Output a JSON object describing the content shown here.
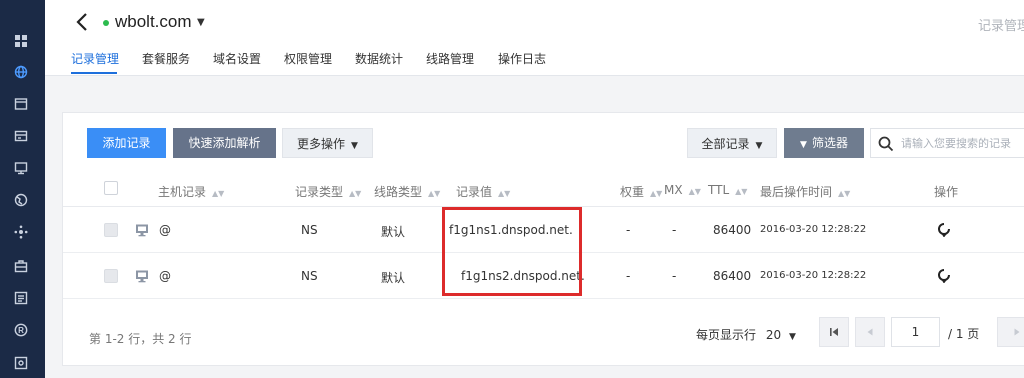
{
  "header": {
    "domain": "wbolt.com",
    "right_title": "记录管理"
  },
  "tabs": [
    {
      "label": "记录管理",
      "active": true
    },
    {
      "label": "套餐服务"
    },
    {
      "label": "域名设置"
    },
    {
      "label": "权限管理"
    },
    {
      "label": "数据统计"
    },
    {
      "label": "线路管理"
    },
    {
      "label": "操作日志"
    }
  ],
  "toolbar": {
    "add_record": "添加记录",
    "quick_add": "快速添加解析",
    "more_actions": "更多操作",
    "all_records": "全部记录",
    "filter": "筛选器",
    "search_placeholder": "请输入您要搜索的记录"
  },
  "table": {
    "columns": {
      "host": "主机记录",
      "type": "记录类型",
      "line": "线路类型",
      "value": "记录值",
      "weight": "权重",
      "mx": "MX",
      "ttl": "TTL",
      "last_op": "最后操作时间",
      "actions": "操作"
    },
    "rows": [
      {
        "host": "@",
        "type": "NS",
        "line": "默认",
        "value": "f1g1ns1.dnspod.net.",
        "weight": "-",
        "mx": "-",
        "ttl": "86400",
        "last_op": "2016-03-20 12:28:22"
      },
      {
        "host": "@",
        "type": "NS",
        "line": "默认",
        "value": "f1g1ns2.dnspod.net.",
        "weight": "-",
        "mx": "-",
        "ttl": "86400",
        "last_op": "2016-03-20 12:28:22"
      }
    ]
  },
  "footer": {
    "summary": "第 1-2 行，共 2 行",
    "per_page_label": "每页显示行",
    "per_page_value": "20",
    "page_current": "1",
    "page_total": "/ 1 页"
  },
  "colors": {
    "sidebar": "#1b2a46",
    "primary": "#3a8ef6",
    "active_tab": "#1d6fdc",
    "status_dot": "#2cbb4e",
    "highlight": "#dd2b2b"
  }
}
